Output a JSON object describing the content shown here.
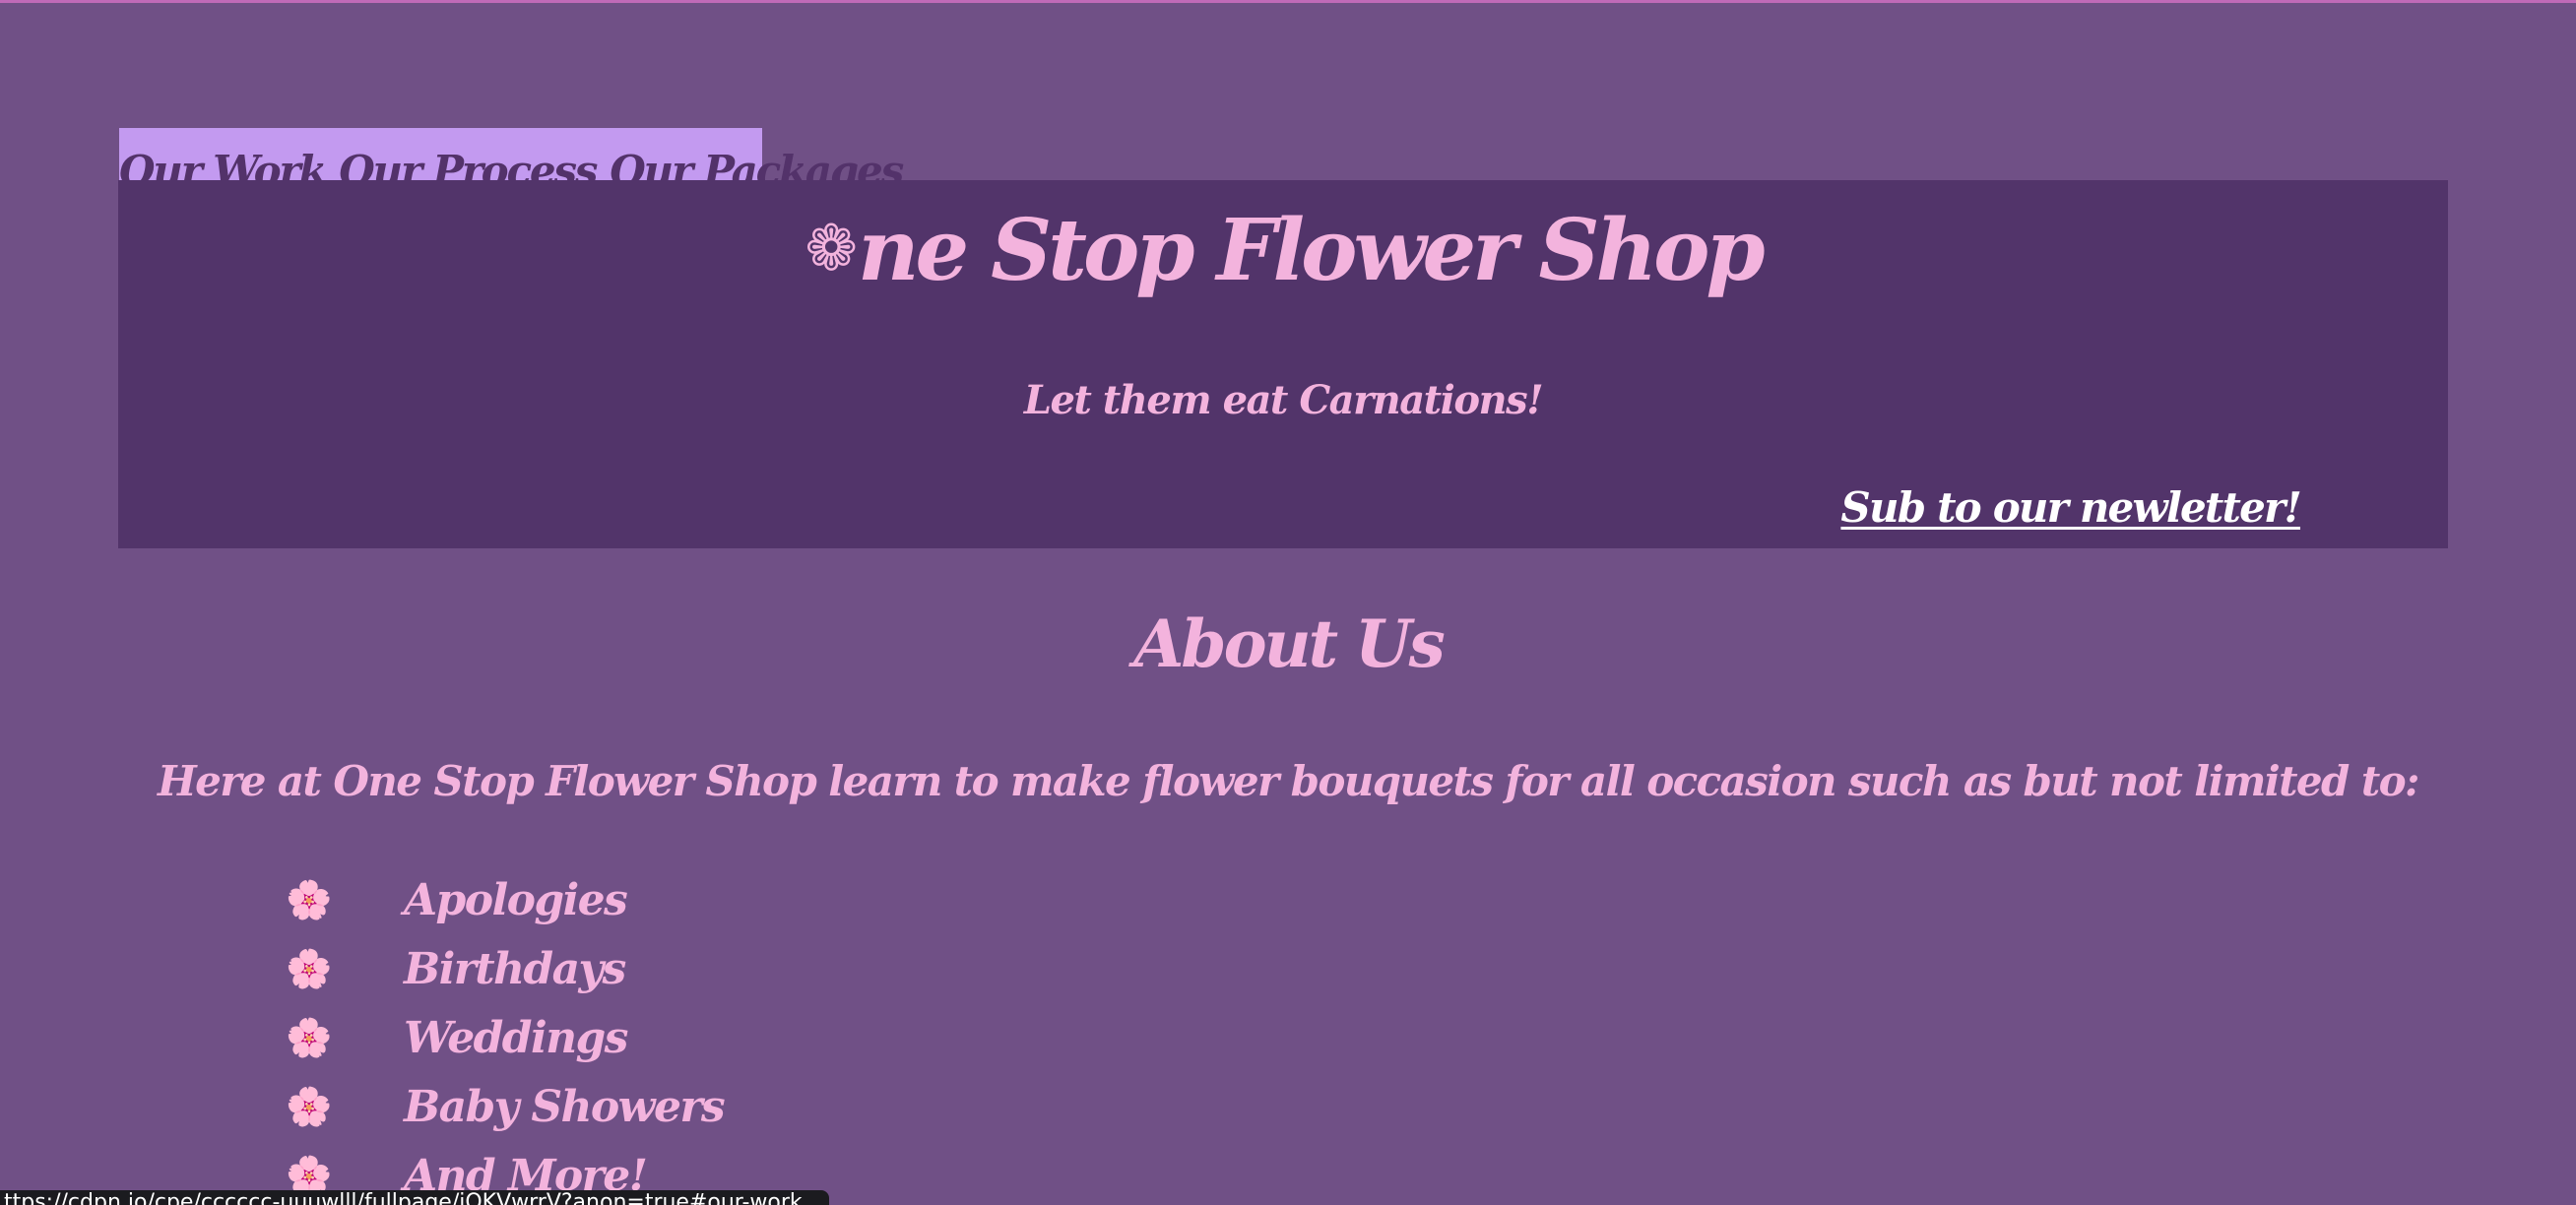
{
  "nav": {
    "links": [
      "Our Work",
      "Our Process",
      "Our Packages"
    ]
  },
  "hero": {
    "title_icon": "❁",
    "title_rest": "ne Stop Flower Shop",
    "tagline": "Let them eat Carnations!",
    "newsletter_link": "Sub to our newletter!"
  },
  "about": {
    "heading": "About Us",
    "intro": "Here at One Stop Flower Shop learn to make flower bouquets for all occasion such as but not limited to:",
    "bullet_icon": "🌸",
    "occasions": [
      "Apologies",
      "Birthdays",
      "Weddings",
      "Baby Showers",
      "And More!"
    ]
  },
  "status_bar": {
    "url": "ttps://cdpn.io/cpe/cccccc-uuuwlll/fullpage/jOKVwrrV?anon=true#our-work"
  },
  "colors": {
    "page_background": "#705086",
    "hero_background": "#52346a",
    "nav_background": "#c39af0",
    "accent_pink": "#f3b3dd",
    "nav_text": "#53326a",
    "link_white": "#ffffff"
  }
}
